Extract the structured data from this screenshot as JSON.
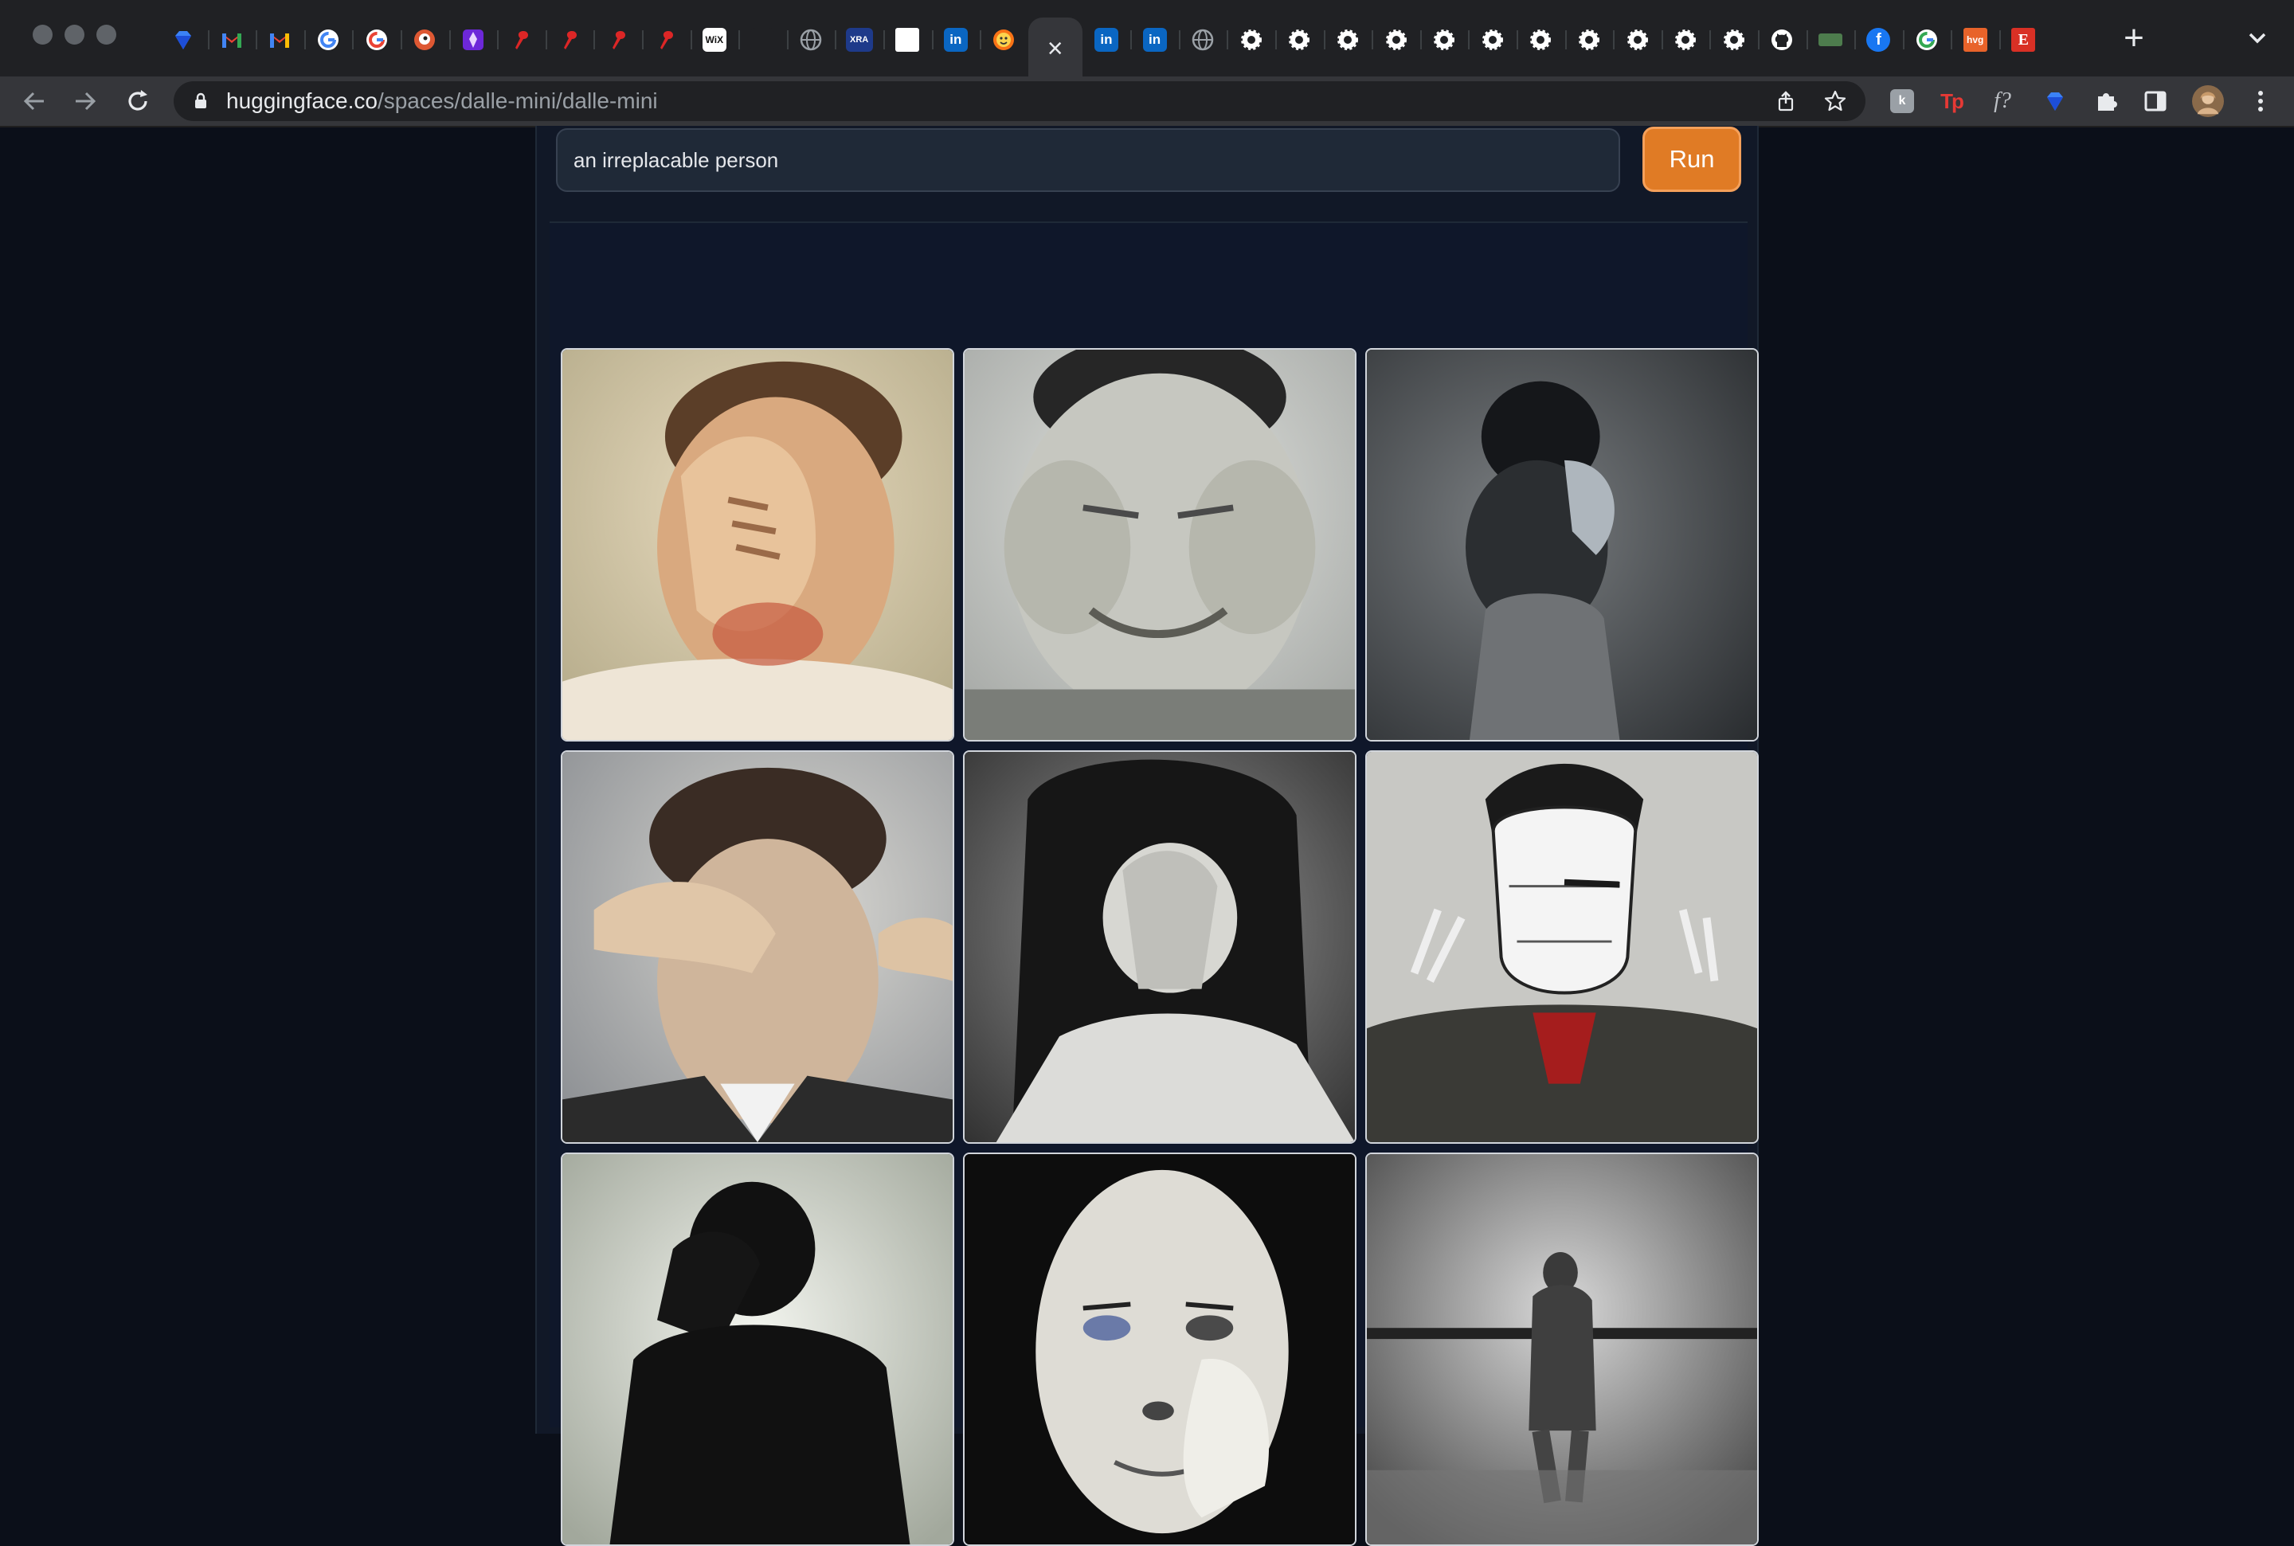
{
  "browser": {
    "url_host": "huggingface.co",
    "url_path": "/spaces/dalle-mini/dalle-mini",
    "tabs": [
      {
        "icon": "gem-icon"
      },
      {
        "icon": "gmail-icon"
      },
      {
        "icon": "gmail-icon"
      },
      {
        "icon": "google-icon"
      },
      {
        "icon": "google-icon"
      },
      {
        "icon": "duckduckgo-icon"
      },
      {
        "icon": "pen-icon"
      },
      {
        "icon": "pin-icon"
      },
      {
        "icon": "pin-icon"
      },
      {
        "icon": "pin-icon"
      },
      {
        "icon": "pin-icon"
      },
      {
        "icon": "wix-icon",
        "text": "WiX"
      },
      {
        "icon": "blank-icon"
      },
      {
        "icon": "globe-icon"
      },
      {
        "icon": "xra-icon",
        "text": "XRA"
      },
      {
        "icon": "white-square-icon"
      },
      {
        "icon": "linkedin-icon",
        "text": "in"
      },
      {
        "icon": "hugging-face-icon"
      },
      {
        "icon": "close-icon",
        "active": true
      },
      {
        "icon": "linkedin-icon",
        "text": "in"
      },
      {
        "icon": "linkedin-icon",
        "text": "in"
      },
      {
        "icon": "globe-icon"
      },
      {
        "icon": "gear-icon"
      },
      {
        "icon": "gear-icon"
      },
      {
        "icon": "gear-icon"
      },
      {
        "icon": "gear-icon"
      },
      {
        "icon": "gear-icon"
      },
      {
        "icon": "gear-icon"
      },
      {
        "icon": "gear-icon"
      },
      {
        "icon": "gear-icon"
      },
      {
        "icon": "gear-icon"
      },
      {
        "icon": "gear-icon"
      },
      {
        "icon": "gear-icon"
      },
      {
        "icon": "github-icon"
      },
      {
        "icon": "green-badge-icon"
      },
      {
        "icon": "facebook-icon",
        "text": "f"
      },
      {
        "icon": "google-icon"
      },
      {
        "icon": "hvg-icon",
        "text": "hvg"
      },
      {
        "icon": "e-icon",
        "text": "E"
      }
    ],
    "extensions": [
      {
        "icon": "k-extension-icon",
        "text": "k"
      },
      {
        "icon": "tp-extension-icon",
        "text": "Tp"
      },
      {
        "icon": "formula-extension-icon",
        "text": "f?"
      },
      {
        "icon": "gem-icon"
      },
      {
        "icon": "puzzle-icon"
      },
      {
        "icon": "sidepanel-icon"
      },
      {
        "icon": "profile-avatar"
      },
      {
        "icon": "kebab-menu-icon"
      }
    ]
  },
  "app": {
    "prompt_value": "an irreplacable person",
    "run_label": "Run",
    "images": [
      {
        "name": "generated-image-1",
        "subject": "man covering face with hand"
      },
      {
        "name": "generated-image-2",
        "subject": "face pressed by hands"
      },
      {
        "name": "generated-image-3",
        "subject": "figure from behind holding head"
      },
      {
        "name": "generated-image-4",
        "subject": "man in suit covering eyes"
      },
      {
        "name": "generated-image-5",
        "subject": "woman covering face"
      },
      {
        "name": "generated-image-6",
        "subject": "masked man in suit"
      },
      {
        "name": "generated-image-7",
        "subject": "silhouette holding head"
      },
      {
        "name": "generated-image-8",
        "subject": "close-up face with hand"
      },
      {
        "name": "generated-image-9",
        "subject": "blurred figure walking away"
      }
    ]
  },
  "colors": {
    "page_bg": "#0b0f19",
    "panel_bg": "#111827",
    "accent": "#e07b25",
    "chrome_tabstrip": "#202124",
    "chrome_toolbar": "#35363a"
  }
}
